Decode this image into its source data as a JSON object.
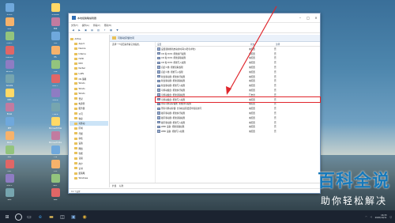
{
  "window": {
    "title": "本地组策略编辑器",
    "menu": [
      "文件(F)",
      "操作(A)",
      "查看(V)",
      "帮助(H)"
    ],
    "toolbar_icons": [
      "back-icon",
      "forward-icon",
      "up-folder-icon",
      "show-hide-tree-icon",
      "export-list-icon",
      "help-icon",
      "properties-icon",
      "filter-icon"
    ],
    "detail_title": "可移动存储访问",
    "description": "选择一个项目来查看它的描述。",
    "columns": [
      "设置",
      "状态",
      "注释"
    ],
    "rows": [
      {
        "name": "设置强制重新启动的时间(以秒为单位)",
        "state": "未配置",
        "note": "否"
      },
      {
        "name": "CD 和 DVD: 拒绝执行权限",
        "state": "未配置",
        "note": "否"
      },
      {
        "name": "CD 和 DVD: 拒绝读取权限",
        "state": "未配置",
        "note": "否"
      },
      {
        "name": "CD 和 DVD: 拒绝写入权限",
        "state": "未配置",
        "note": "否"
      },
      {
        "name": "自定义类: 拒绝读取权限",
        "state": "未配置",
        "note": "否"
      },
      {
        "name": "自定义类: 拒绝写入权限",
        "state": "未配置",
        "note": "否"
      },
      {
        "name": "软盘驱动器: 拒绝执行权限",
        "state": "未配置",
        "note": "否"
      },
      {
        "name": "软盘驱动器: 拒绝读取权限",
        "state": "未配置",
        "note": "否"
      },
      {
        "name": "软盘驱动器: 拒绝写入权限",
        "state": "未配置",
        "note": "否"
      },
      {
        "name": "可移动磁盘: 拒绝执行权限",
        "state": "未配置",
        "note": "否"
      },
      {
        "name": "可移动磁盘: 拒绝读取权限",
        "state": "已启用",
        "note": "否"
      },
      {
        "name": "可移动磁盘: 拒绝写入权限",
        "state": "未配置",
        "note": "否"
      },
      {
        "name": "所有可移动存储类: 拒绝所有权限",
        "state": "未配置",
        "note": "否"
      },
      {
        "name": "所有可移动存储: 允许在远程会话中直接访问",
        "state": "未配置",
        "note": "否"
      },
      {
        "name": "磁带驱动器: 拒绝执行权限",
        "state": "未配置",
        "note": "否"
      },
      {
        "name": "磁带驱动器: 拒绝读取权限",
        "state": "未配置",
        "note": "否"
      },
      {
        "name": "磁带驱动器: 拒绝写入权限",
        "state": "未配置",
        "note": "否"
      },
      {
        "name": "WPD 设备: 拒绝读取权限",
        "state": "未配置",
        "note": "否"
      },
      {
        "name": "WPD 设备: 拒绝写入权限",
        "state": "未配置",
        "note": "否"
      }
    ],
    "highlighted_row": 11,
    "tabs": [
      "扩展",
      "标准"
    ],
    "status": "19 个设置",
    "tree": [
      {
        "label": "Active"
      },
      {
        "label": "App-V"
      },
      {
        "label": "Device"
      },
      {
        "label": "Interne"
      },
      {
        "label": "iSCSI"
      },
      {
        "label": "KDC"
      },
      {
        "label": "Kerber"
      },
      {
        "label": "LAPS"
      },
      {
        "label": "OS 策略"
      },
      {
        "label": "Windo"
      },
      {
        "label": "Windo"
      },
      {
        "label": "Windo"
      },
      {
        "label": "登录"
      },
      {
        "label": "电源管"
      },
      {
        "label": "服务器"
      },
      {
        "label": "公司"
      },
      {
        "label": "恢复"
      },
      {
        "label": "可移动"
      },
      {
        "label": "区域"
      },
      {
        "label": "凭据"
      },
      {
        "label": "审核"
      },
      {
        "label": "设备"
      },
      {
        "label": "网络"
      },
      {
        "label": "性能"
      },
      {
        "label": "音频"
      },
      {
        "label": "用户"
      },
      {
        "label": "证书"
      },
      {
        "label": "组策略"
      },
      {
        "label": "Windows"
      }
    ],
    "selected_tree_index": 17
  },
  "desktop_icons": [
    {
      "label": "此电脑"
    },
    {
      "label": "网络"
    },
    {
      "label": "回收站"
    },
    {
      "label": "控制面板"
    },
    {
      "label": "腾讯QQ"
    },
    {
      "label": "Google"
    },
    {
      "label": "WPS"
    },
    {
      "label": "Excel"
    },
    {
      "label": "PPT"
    },
    {
      "label": "Word"
    },
    {
      "label": "微信"
    },
    {
      "label": "钉钉"
    },
    {
      "label": "爱奇艺"
    },
    {
      "label": "酷狗"
    },
    {
      "label": "百度网盘"
    },
    {
      "label": "360"
    },
    {
      "label": "录屏"
    },
    {
      "label": "PS"
    },
    {
      "label": "迅雷"
    },
    {
      "label": "网易云"
    },
    {
      "label": "浏览器"
    },
    {
      "label": "记事本"
    },
    {
      "label": "Microsoft Edge"
    },
    {
      "label": "Microsoft Store"
    },
    {
      "label": "工具"
    },
    {
      "label": "文档"
    },
    {
      "label": "图片"
    },
    {
      "label": "视频"
    }
  ],
  "taskbar": {
    "time": "16:33",
    "date": "2020/10/11",
    "apps": [
      "start-icon",
      "search-icon",
      "task-view-icon",
      "edge-icon",
      "file-explorer-icon",
      "store-icon",
      "gpedit-icon",
      "chrome-icon"
    ]
  },
  "watermark": {
    "line1": "百科全说",
    "line2": "助你轻松解决"
  },
  "colors": {
    "highlight": "#e0252b",
    "watermark": "#1679bb"
  }
}
